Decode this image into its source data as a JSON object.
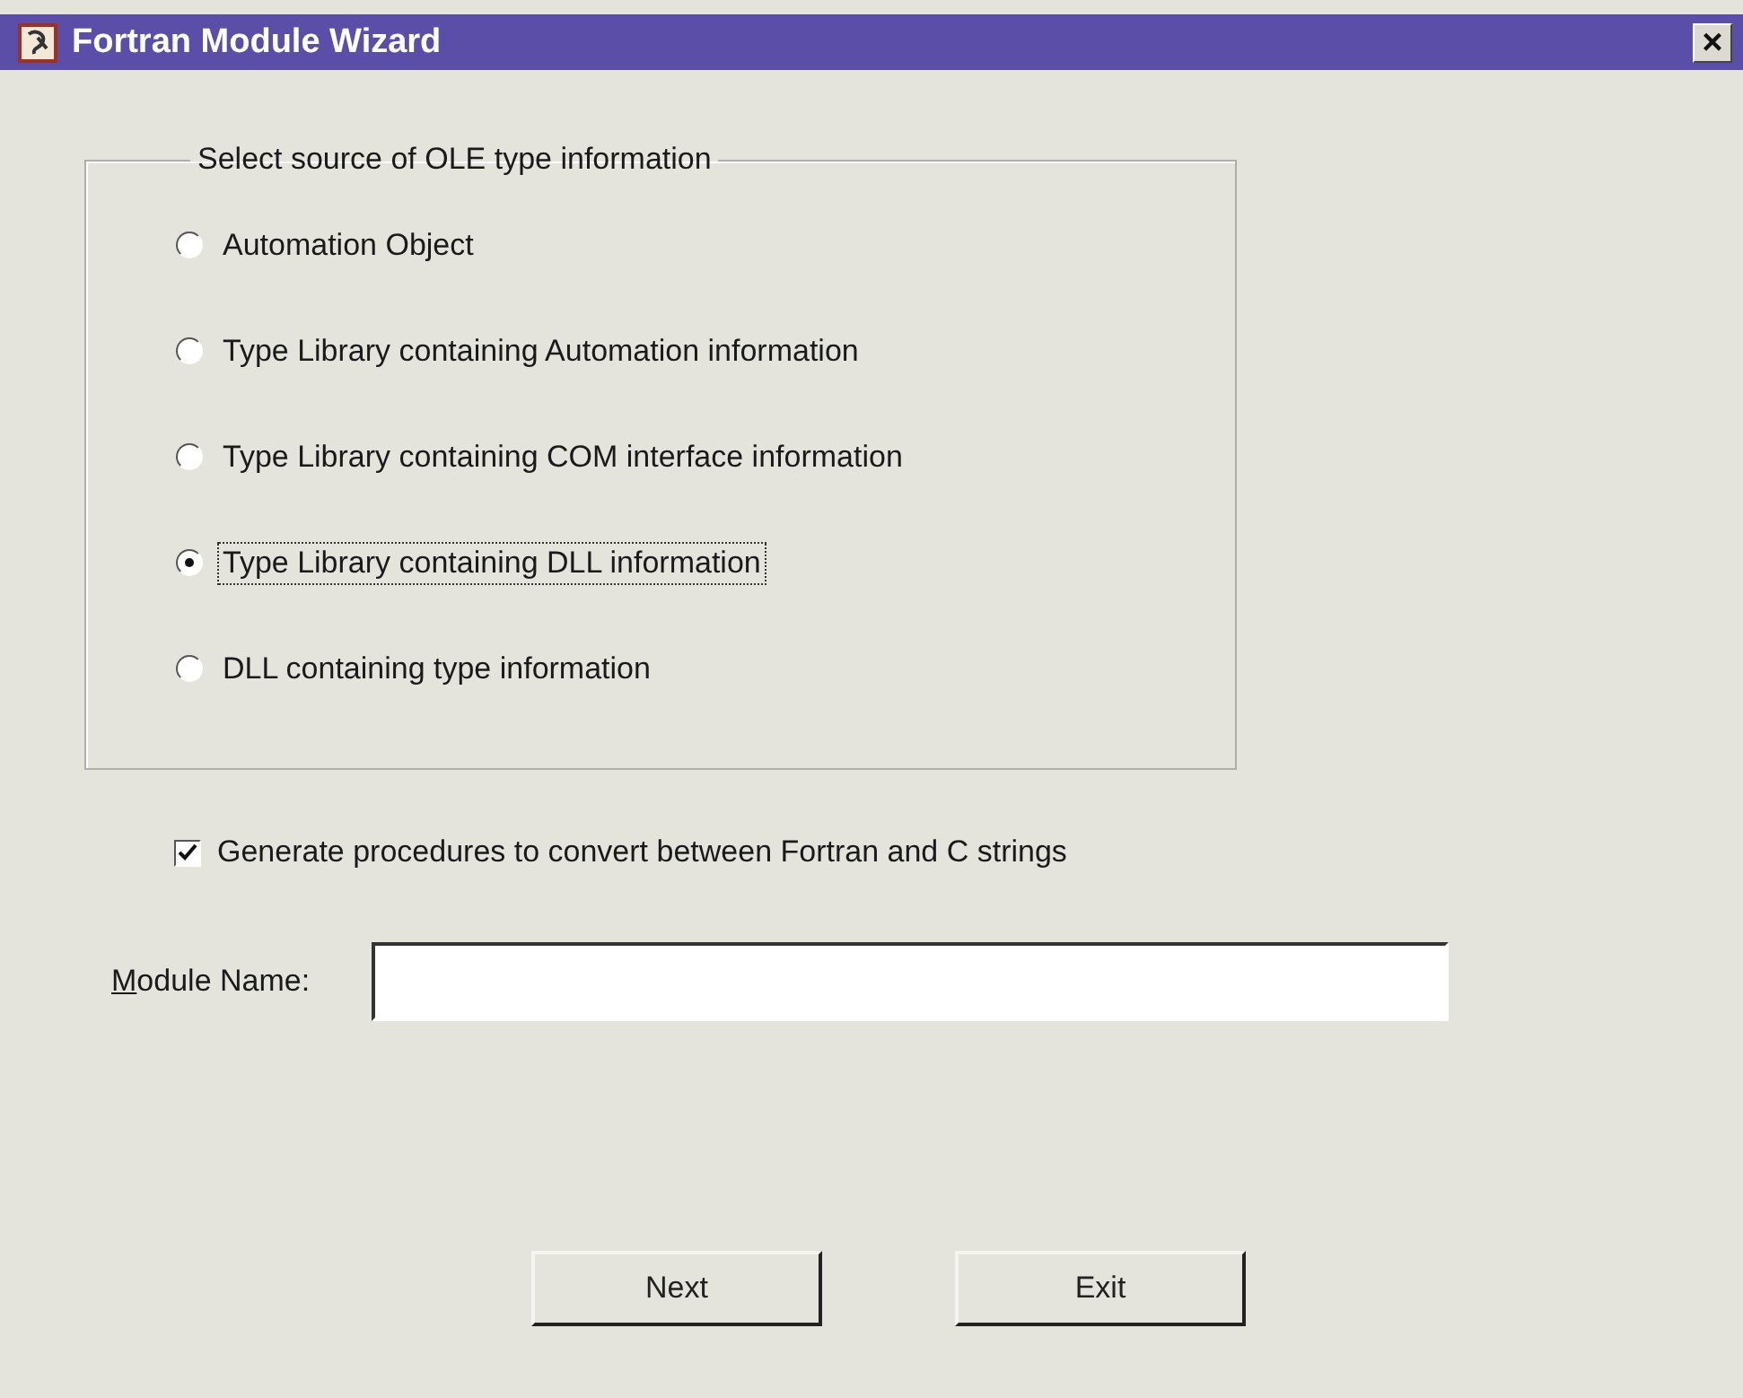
{
  "window": {
    "title": "Fortran Module Wizard",
    "close": "×"
  },
  "source_group": {
    "title": "Select source of OLE type information",
    "options": [
      {
        "label": "Automation Object",
        "selected": false,
        "focused": false
      },
      {
        "label": "Type Library containing Automation information",
        "selected": false,
        "focused": false
      },
      {
        "label": "Type Library containing COM interface information",
        "selected": false,
        "focused": false
      },
      {
        "label": "Type Library containing DLL information",
        "selected": true,
        "focused": true
      },
      {
        "label": "DLL containing type information",
        "selected": false,
        "focused": false
      }
    ]
  },
  "generate_option": {
    "label": "Generate procedures to convert between Fortran and C strings",
    "checked": true
  },
  "module_name": {
    "label": "Module Name:",
    "first_letter_underlined": true
  },
  "buttons": [
    {
      "label": "Next"
    },
    {
      "label": "Exit"
    }
  ]
}
